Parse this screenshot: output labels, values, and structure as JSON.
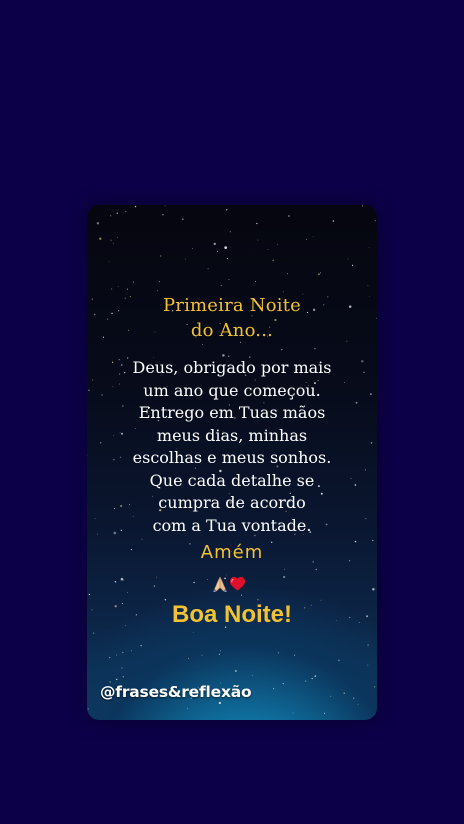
{
  "post": {
    "title_lines": [
      "Primeira Noite",
      "do Ano..."
    ],
    "body_lines": [
      "Deus, obrigado por mais",
      "um ano que começou.",
      "Entrego em Tuas mãos",
      "meus dias, minhas",
      "escolhas e meus sonhos.",
      "Que cada detalhe se",
      "cumpra de acordo",
      "com a Tua vontade."
    ],
    "amen": "Amém",
    "emoji_icons": [
      "praying-hands-icon",
      "red-heart-icon"
    ],
    "closing": "Boa Noite!",
    "handle": "@frases&reflexão"
  },
  "colors": {
    "background": "#0c0148",
    "accent_gold": "#f2c230",
    "text_white": "#ffffff",
    "sky_glow": "#18a4d0"
  }
}
